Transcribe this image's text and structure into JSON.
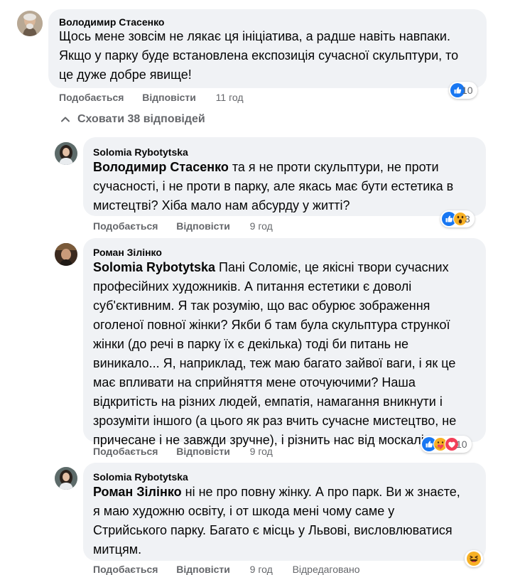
{
  "thread": {
    "hide_replies_label": "Сховати 38 відповідей"
  },
  "comments": [
    {
      "author": "Володимир Стасенко",
      "mention": "",
      "lines": [
        "Щось мене зовсім не лякає ця ініціатива, а радше навіть навпаки.",
        "Якщо у парку буде встановлена експозиція сучасної скульптури, то",
        "це дуже добре явище!"
      ],
      "like_label": "Подобається",
      "reply_label": "Відповісти",
      "time": "11 год",
      "reaction_count": "10",
      "edited": ""
    },
    {
      "author": "Solomia Rybotytska",
      "mention": "Володимир Стасенко",
      "lines": [
        " та я не проти скульптури, не проти",
        "сучасності, і не проти в парку, але якась має бути естетика в",
        "мистецтві? Хіба мало нам абсурду у житті?"
      ],
      "like_label": "Подобається",
      "reply_label": "Відповісти",
      "time": "9 год",
      "reaction_count": "3",
      "edited": ""
    },
    {
      "author": "Роман Зілінко",
      "mention": "Solomia Rybotytska",
      "lines": [
        " Пані Соломіє, це якісні твори сучасних",
        "професійних художників. А питання естетики є доволі",
        "суб'єктивним. Я так розумію, що вас обурює зображення",
        "оголеної повної жінки? Якби б там була скульптура стрункої",
        "жінки (до речі в парку їх є декілька) тоді би питань не",
        "виникало... Я, наприклад, теж маю багато зайвої ваги, і як це",
        "має впливати на сприйняття мене оточуючими? Наша",
        "відкритість на різних людей, емпатія, намагання вникнути і",
        "зрозуміти іншого (а цього як раз вчить сучасне мистецтво, не",
        "причесане і не завжди зручне), і різнить нас від москалів."
      ],
      "like_label": "Подобається",
      "reply_label": "Відповісти",
      "time": "9 год",
      "reaction_count": "10",
      "edited": ""
    },
    {
      "author": "Solomia Rybotytska",
      "mention": "Роман Зілінко",
      "lines": [
        " ні не про повну жінку. А про парк. Ви ж знаєте,",
        "я маю художню освіту, і от шкода мені чому саме у",
        "Стрийського парку. Багато є місць у Львові, висловлюватися",
        "митцям."
      ],
      "like_label": "Подобається",
      "reply_label": "Відповісти",
      "time": "9 год",
      "reaction_count": "",
      "edited": "Відредаговано"
    }
  ],
  "colors": {
    "bubble": "#f0f2f5",
    "meta": "#65676b",
    "like_blue": "#1877f2",
    "love_red": "#f33e58",
    "haha_yellow": "#f7b125"
  },
  "icons": {
    "like": "like-reaction-icon",
    "wow": "wow-reaction-icon",
    "care": "care-reaction-icon",
    "love": "love-reaction-icon",
    "haha": "haha-reaction-icon",
    "chevron": "chevron-up-icon"
  }
}
